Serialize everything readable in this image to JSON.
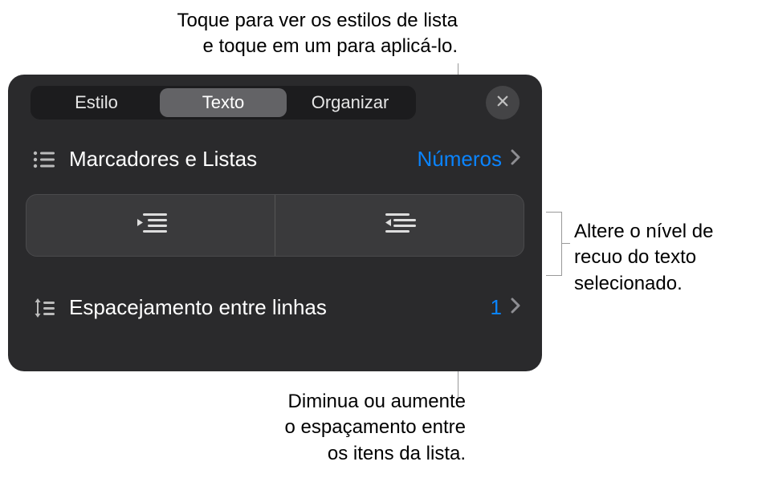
{
  "callouts": {
    "top_line1": "Toque para ver os estilos de lista",
    "top_line2": "e toque em um para aplicá-lo.",
    "right_line1": "Altere o nível de",
    "right_line2": "recuo do texto",
    "right_line3": "selecionado.",
    "bottom_line1": "Diminua ou aumente",
    "bottom_line2": "o espaçamento entre",
    "bottom_line3": "os itens da lista."
  },
  "tabs": {
    "style": "Estilo",
    "text": "Texto",
    "arrange": "Organizar"
  },
  "bullets_row": {
    "label": "Marcadores e Listas",
    "value": "Números"
  },
  "line_spacing_row": {
    "label": "Espacejamento entre linhas",
    "value": "1"
  }
}
